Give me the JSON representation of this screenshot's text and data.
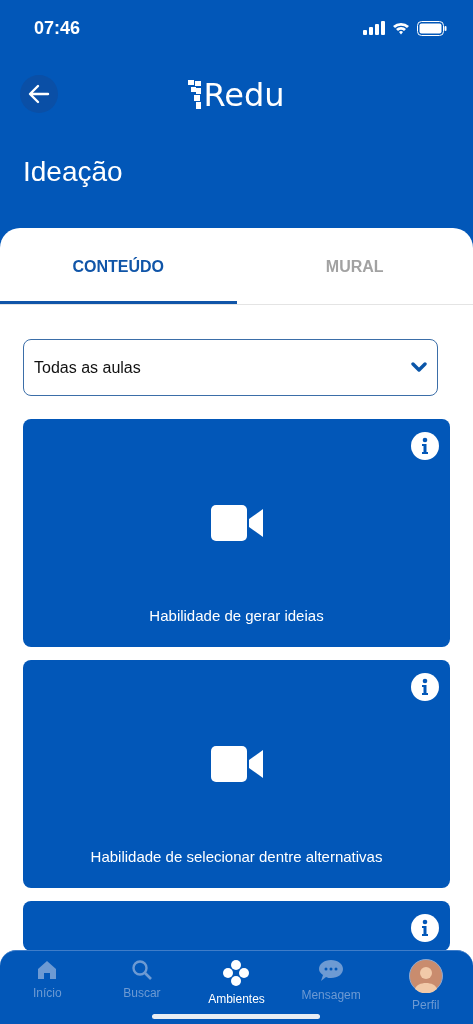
{
  "status_bar": {
    "time": "07:46"
  },
  "header": {
    "logo": "Redu",
    "title": "Ideação"
  },
  "tabs": [
    {
      "label": "CONTEÚDO",
      "selected": true
    },
    {
      "label": "MURAL",
      "selected": false
    }
  ],
  "filter": {
    "value": "Todas as aulas"
  },
  "lessons": [
    {
      "title": "Habilidade de gerar ideias",
      "kind": "video"
    },
    {
      "title": "Habilidade de selecionar dentre alternativas",
      "kind": "video"
    },
    {
      "kind": "partial"
    }
  ],
  "bottom_nav": [
    {
      "label": "Início",
      "kind": "home",
      "selected": false
    },
    {
      "label": "Buscar",
      "kind": "search",
      "selected": false
    },
    {
      "label": "Ambientes",
      "kind": "dots",
      "selected": true
    },
    {
      "label": "Mensagem",
      "kind": "chat",
      "selected": false
    },
    {
      "label": "Perfil",
      "kind": "avatar",
      "selected": false
    }
  ]
}
